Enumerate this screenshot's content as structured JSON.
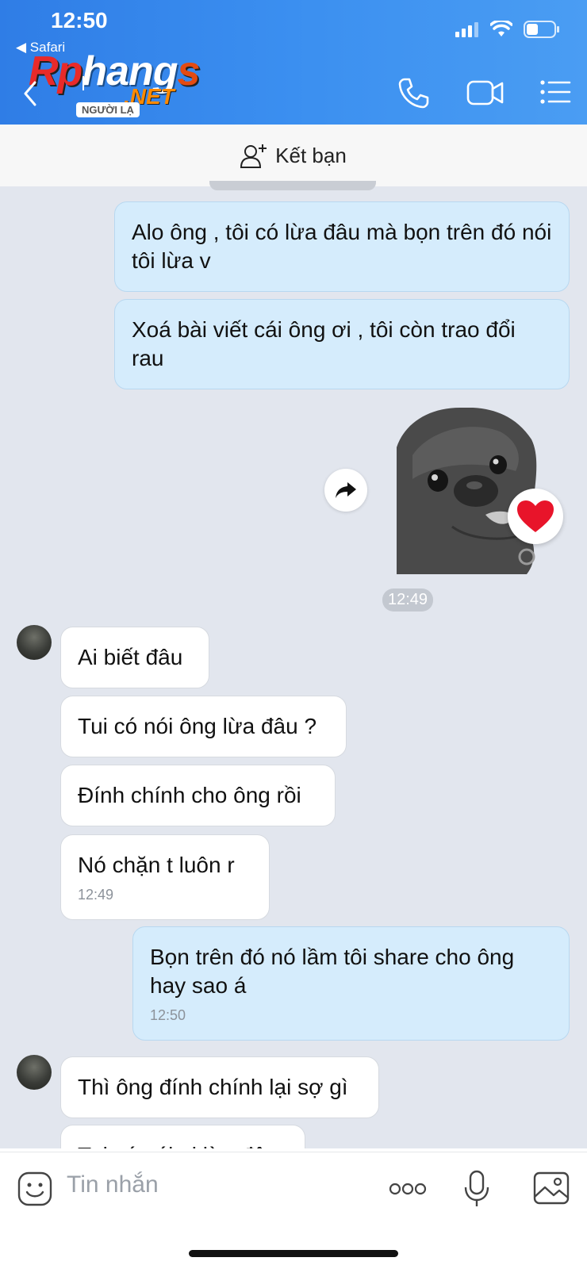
{
  "status": {
    "time": "12:50",
    "back_app": "◀ Safari"
  },
  "header": {
    "logo_part1": "Rp",
    "logo_part2": "hang",
    "logo_part3": "s",
    "logo_net": ".NET",
    "stranger_label": "NGƯỜI LẠ",
    "icons": [
      "back-chevron-icon",
      "phone-icon",
      "video-call-icon",
      "menu-list-icon"
    ]
  },
  "friend_bar": {
    "label": "Kết bạn",
    "icon": "add-person-icon"
  },
  "messages": [
    {
      "side": "out",
      "text": "Alo ông , tôi có lừa đâu mà bọn trên đó nói tôi lừa v"
    },
    {
      "side": "out",
      "text": "Xoá bài viết cái ông ơi , tôi còn trao đổi rau"
    },
    {
      "side": "out",
      "type": "sticker",
      "reaction": "heart",
      "time": "12:49"
    },
    {
      "side": "in",
      "text": "Ai biết đâu"
    },
    {
      "side": "in",
      "text": "Tui có nói ông lừa đâu ?"
    },
    {
      "side": "in",
      "text": "Đính chính cho ông rồi"
    },
    {
      "side": "in",
      "text": "Nó chặn t luôn r",
      "time": "12:49"
    },
    {
      "side": "out",
      "text": "Bọn trên đó nó lầm tôi share cho ông hay sao á",
      "time": "12:50"
    },
    {
      "side": "in",
      "text": "Thì ông đính chính lại sợ gì"
    },
    {
      "side": "in",
      "text": "Tui có nói ai lừa đâu"
    }
  ],
  "input": {
    "placeholder": "Tin nhắn",
    "icons": [
      "sticker-icon",
      "more-icon",
      "microphone-icon",
      "image-icon"
    ]
  }
}
